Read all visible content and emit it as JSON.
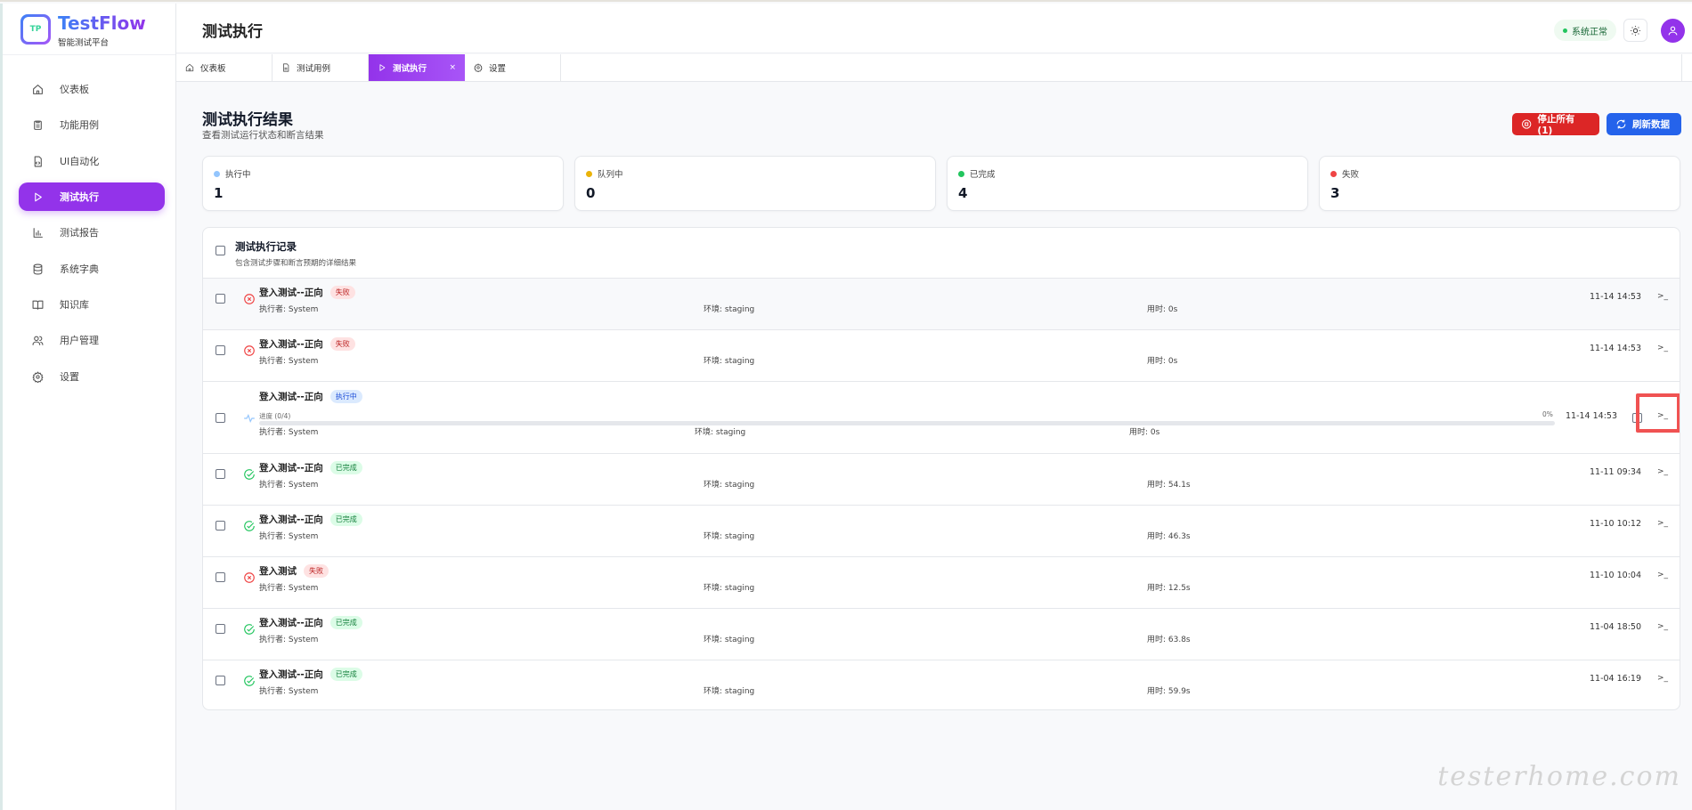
{
  "brand": {
    "name": "TestFlow",
    "subtitle": "智能测试平台",
    "logo_text": "TP"
  },
  "sidebar": {
    "items": [
      {
        "label": "仪表板",
        "icon": "home-icon"
      },
      {
        "label": "功能用例",
        "icon": "clipboard-icon"
      },
      {
        "label": "UI自动化",
        "icon": "file-code-icon"
      },
      {
        "label": "测试执行",
        "icon": "play-icon",
        "active": true
      },
      {
        "label": "测试报告",
        "icon": "bar-chart-icon"
      },
      {
        "label": "系统字典",
        "icon": "database-icon"
      },
      {
        "label": "知识库",
        "icon": "book-icon"
      },
      {
        "label": "用户管理",
        "icon": "users-icon"
      },
      {
        "label": "设置",
        "icon": "gear-icon"
      }
    ]
  },
  "header": {
    "title": "测试执行",
    "status": "系统正常"
  },
  "tabs": [
    {
      "label": "仪表板",
      "icon": "home-icon"
    },
    {
      "label": "测试用例",
      "icon": "file-icon"
    },
    {
      "label": "测试执行",
      "icon": "play-icon",
      "active": true,
      "close": "×"
    },
    {
      "label": "设置",
      "icon": "gear-icon"
    }
  ],
  "page": {
    "title": "测试执行结果",
    "subtitle": "查看测试运行状态和断言结果",
    "stop_label": "停止所有 (1)",
    "refresh_label": "刷新数据"
  },
  "stats": [
    {
      "label": "执行中",
      "value": "1",
      "color": "#93c5fd"
    },
    {
      "label": "队列中",
      "value": "0",
      "color": "#eab308"
    },
    {
      "label": "已完成",
      "value": "4",
      "color": "#22c55e"
    },
    {
      "label": "失败",
      "value": "3",
      "color": "#ef4444"
    }
  ],
  "list": {
    "title": "测试执行记录",
    "subtitle": "包含测试步骤和断言预期的详细结果",
    "rows": [
      {
        "name": "登入测试--正向",
        "status": "fail",
        "badge": "失败",
        "executor": "执行者: System",
        "env": "环境: staging",
        "duration": "用时: 0s",
        "time": "11-14 14:53",
        "action": ">_"
      },
      {
        "name": "登入测试--正向",
        "status": "fail",
        "badge": "失败",
        "executor": "执行者: System",
        "env": "环境: staging",
        "duration": "用时: 0s",
        "time": "11-14 14:53",
        "action": ">_"
      },
      {
        "name": "登入测试--正向",
        "status": "run",
        "badge": "执行中",
        "progress_label": "进度 (0/4)",
        "progress": 0,
        "progress_pct": "0%",
        "executor": "执行者: System",
        "env": "环境: staging",
        "duration": "用时: 0s",
        "time": "11-14 14:53",
        "action": ">_"
      },
      {
        "name": "登入测试--正向",
        "status": "ok",
        "badge": "已完成",
        "executor": "执行者: System",
        "env": "环境: staging",
        "duration": "用时: 54.1s",
        "time": "11-11 09:34",
        "action": ">_"
      },
      {
        "name": "登入测试--正向",
        "status": "ok",
        "badge": "已完成",
        "executor": "执行者: System",
        "env": "环境: staging",
        "duration": "用时: 46.3s",
        "time": "11-10 10:12",
        "action": ">_"
      },
      {
        "name": "登入测试",
        "status": "fail",
        "badge": "失败",
        "executor": "执行者: System",
        "env": "环境: staging",
        "duration": "用时: 12.5s",
        "time": "11-10 10:04",
        "action": ">_"
      },
      {
        "name": "登入测试--正向",
        "status": "ok",
        "badge": "已完成",
        "executor": "执行者: System",
        "env": "环境: staging",
        "duration": "用时: 63.8s",
        "time": "11-04 18:50",
        "action": ">_"
      },
      {
        "name": "登入测试--正向",
        "status": "ok",
        "badge": "已完成",
        "executor": "执行者: System",
        "env": "环境: staging",
        "duration": "用时: 59.9s",
        "time": "11-04 16:19",
        "action": ">_"
      }
    ]
  },
  "watermark": "testerhome.com"
}
